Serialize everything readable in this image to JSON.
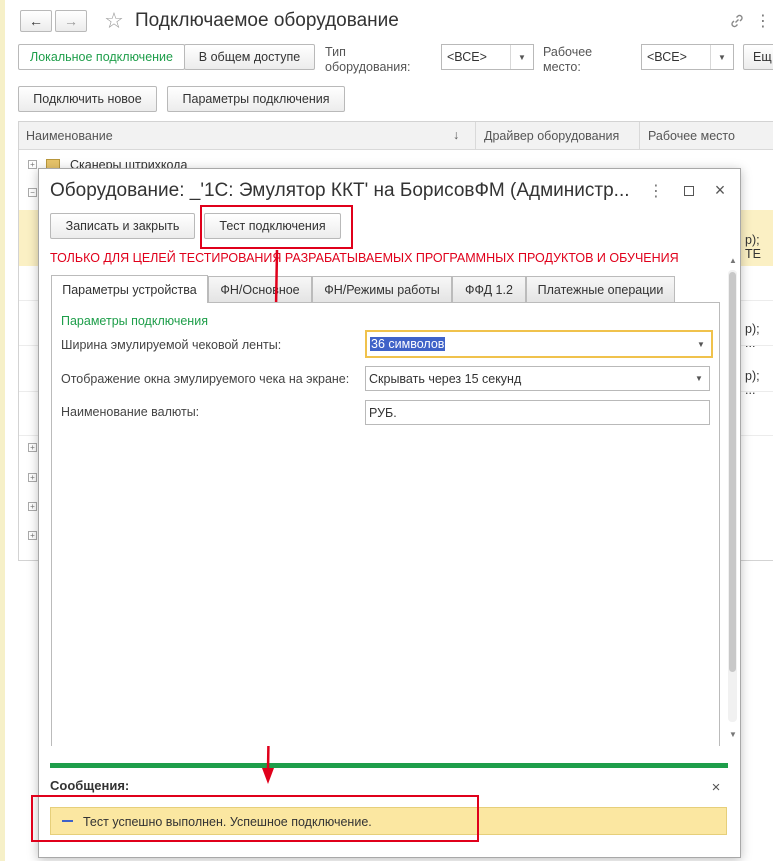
{
  "main_window": {
    "title": "Подключаемое оборудование",
    "nav": {
      "back": "←",
      "forward": "→",
      "star": "☆",
      "link": "🔗",
      "menu": "⋮"
    },
    "filter": {
      "local_label": "Локальное подключение",
      "shared_label": "В общем доступе",
      "type_label_line1": "Тип",
      "type_label_line2": "оборудования:",
      "type_value": "<ВСЕ>",
      "workplace_label_line1": "Рабочее",
      "workplace_label_line2": "место:",
      "workplace_value": "<ВСЕ>",
      "more_label": "Ещ"
    },
    "toolbar": {
      "connect_new": "Подключить новое",
      "connection_params": "Параметры подключения"
    },
    "table": {
      "headers": {
        "name": "Наименование",
        "sort": "↓",
        "driver": "Драйвер оборудования",
        "workplace": "Рабочее место"
      },
      "group_row": "Сканеры штрихкода",
      "cut_text_1": "р); ТЕ",
      "cut_text_2": "р); ...",
      "cut_text_3": "р); ..."
    }
  },
  "dialog": {
    "title": "Оборудование: _'1С: Эмулятор ККТ' на БорисовФМ (Администр...",
    "buttons": {
      "save_close": "Записать и закрыть",
      "test": "Тест подключения"
    },
    "warning": "ТОЛЬКО ДЛЯ ЦЕЛЕЙ ТЕСТИРОВАНИЯ РАЗРАБАТЫВАЕМЫХ ПРОГРАММНЫХ ПРОДУКТОВ И ОБУЧЕНИЯ",
    "tabs": [
      "Параметры устройства",
      "ФН/Основное",
      "ФН/Режимы работы",
      "ФФД 1.2",
      "Платежные операции"
    ],
    "section_title": "Параметры подключения",
    "fields": {
      "tape_width_label": "Ширина эмулируемой чековой ленты:",
      "tape_width_value": "36 символов",
      "receipt_window_label": "Отображение окна эмулируемого чека на экране:",
      "receipt_window_value": "Скрывать через 15 секунд",
      "currency_label": "Наименование валюты:",
      "currency_value": "РУБ."
    },
    "messages": {
      "title": "Сообщения:",
      "close": "×",
      "text": "Тест успешно выполнен. Успешное подключение."
    }
  },
  "colors": {
    "accent_green": "#1e9e4a",
    "warning_red": "#e0001b",
    "message_yellow": "#fbe7a1",
    "focus_yellow": "#f0c24c",
    "selection_blue": "#3f62c8"
  }
}
